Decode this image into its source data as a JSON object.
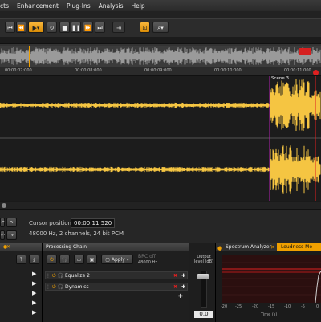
{
  "menu": [
    "cts",
    "Enhancement",
    "Plug-Ins",
    "Analysis",
    "Help"
  ],
  "ruler_times": [
    "00:00:07:000",
    "00:00:08:000",
    "00:00:09:000",
    "00:00:10:000",
    "00:00:11:000"
  ],
  "scene_label": "Scene 3",
  "info": {
    "cursor_label": "Cursor position:",
    "cursor_value": "00:00:11:520",
    "format": "48000 Hz, 2 channels, 24 bit PCM"
  },
  "processing": {
    "title": "Processing Chain",
    "apply_label": "Apply",
    "brc": "BRC off",
    "rate": "48000 Hz",
    "items": [
      "Equalize 2",
      "Dynamics"
    ]
  },
  "output": {
    "label": "Output level (dB)",
    "value": "0.0"
  },
  "analyzer": {
    "tab_spectrum": "Spectrum Analyzer",
    "tab_loudness": "Loudness Me",
    "x_ticks": [
      "-20",
      "-25",
      "-20",
      "-15",
      "-10",
      "-5",
      "0"
    ],
    "x_label": "Time (s)"
  },
  "colors": {
    "waveform": "#f5c542",
    "accent": "#f0a000",
    "marker": "#b020b0",
    "cursor": "#e02020"
  }
}
